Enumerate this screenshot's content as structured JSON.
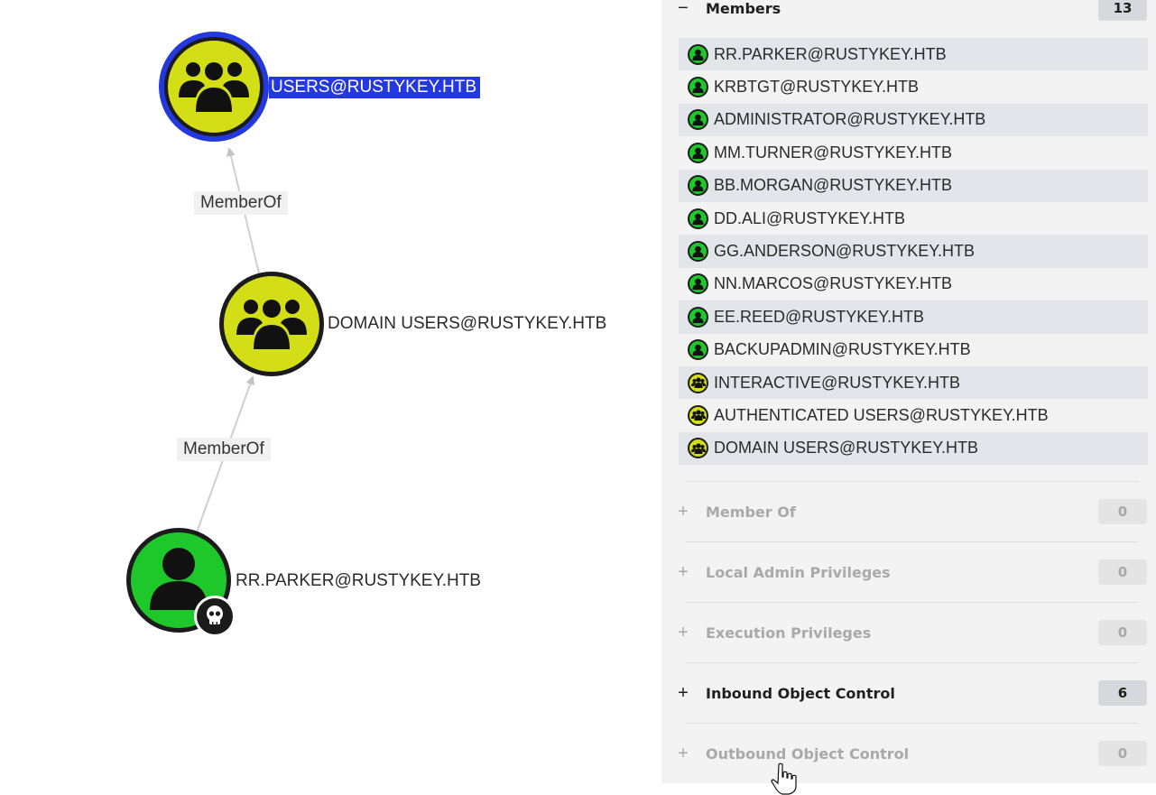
{
  "graph": {
    "nodes": {
      "users_group": {
        "label": "USERS@RUSTYKEY.HTB",
        "icon": "group-icon",
        "color": "#d4de16",
        "selected": true
      },
      "domain_users_group": {
        "label": "DOMAIN USERS@RUSTYKEY.HTB",
        "icon": "group-icon",
        "color": "#d4de16"
      },
      "user_rr_parker": {
        "label": "RR.PARKER@RUSTYKEY.HTB",
        "icon": "user-icon",
        "color": "#1ec82a",
        "badge": "skull-icon"
      }
    },
    "edges": [
      {
        "from": "RR.PARKER@RUSTYKEY.HTB",
        "to": "DOMAIN USERS@RUSTYKEY.HTB",
        "label": "MemberOf"
      },
      {
        "from": "DOMAIN USERS@RUSTYKEY.HTB",
        "to": "USERS@RUSTYKEY.HTB",
        "label": "MemberOf"
      }
    ]
  },
  "panel": {
    "members": {
      "sign": "−",
      "title": "Members",
      "count": "13",
      "items": [
        {
          "name": "RR.PARKER@RUSTYKEY.HTB",
          "type": "user"
        },
        {
          "name": "KRBTGT@RUSTYKEY.HTB",
          "type": "user"
        },
        {
          "name": "ADMINISTRATOR@RUSTYKEY.HTB",
          "type": "user"
        },
        {
          "name": "MM.TURNER@RUSTYKEY.HTB",
          "type": "user"
        },
        {
          "name": "BB.MORGAN@RUSTYKEY.HTB",
          "type": "user"
        },
        {
          "name": "DD.ALI@RUSTYKEY.HTB",
          "type": "user"
        },
        {
          "name": "GG.ANDERSON@RUSTYKEY.HTB",
          "type": "user"
        },
        {
          "name": "NN.MARCOS@RUSTYKEY.HTB",
          "type": "user"
        },
        {
          "name": "EE.REED@RUSTYKEY.HTB",
          "type": "user"
        },
        {
          "name": "BACKUPADMIN@RUSTYKEY.HTB",
          "type": "user"
        },
        {
          "name": "INTERACTIVE@RUSTYKEY.HTB",
          "type": "group"
        },
        {
          "name": "AUTHENTICATED USERS@RUSTYKEY.HTB",
          "type": "group"
        },
        {
          "name": "DOMAIN USERS@RUSTYKEY.HTB",
          "type": "group"
        }
      ]
    },
    "sections": [
      {
        "key": "member_of",
        "sign": "+",
        "title": "Member Of",
        "count": "0",
        "active": false
      },
      {
        "key": "local_admin",
        "sign": "+",
        "title": "Local Admin Privileges",
        "count": "0",
        "active": false
      },
      {
        "key": "execution",
        "sign": "+",
        "title": "Execution Privileges",
        "count": "0",
        "active": false
      },
      {
        "key": "inbound",
        "sign": "+",
        "title": "Inbound Object Control",
        "count": "6",
        "active": true
      },
      {
        "key": "outbound",
        "sign": "+",
        "title": "Outbound Object Control",
        "count": "0",
        "active": false
      }
    ]
  },
  "colors": {
    "user_node": "#1ec82a",
    "group_node": "#d4de16",
    "selection": "#2438e0"
  }
}
